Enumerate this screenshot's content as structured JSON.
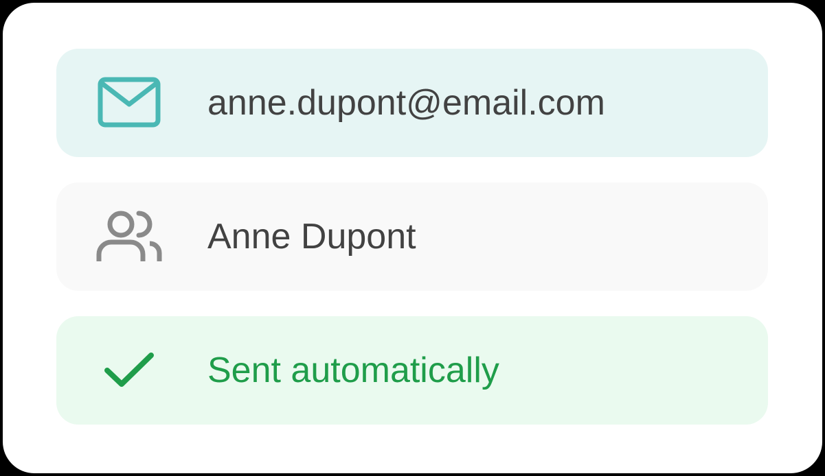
{
  "colors": {
    "email_row_bg": "#e6f5f4",
    "email_icon": "#4ab8b4",
    "name_row_bg": "#f9f9f9",
    "name_icon": "#8a8a8a",
    "status_row_bg": "#eafaef",
    "status_accent": "#1f9d4a",
    "text_default": "#424242"
  },
  "rows": [
    {
      "icon": "envelope-icon",
      "label": "anne.dupont@email.com"
    },
    {
      "icon": "users-icon",
      "label": "Anne Dupont"
    },
    {
      "icon": "checkmark-icon",
      "label": "Sent automatically"
    }
  ]
}
